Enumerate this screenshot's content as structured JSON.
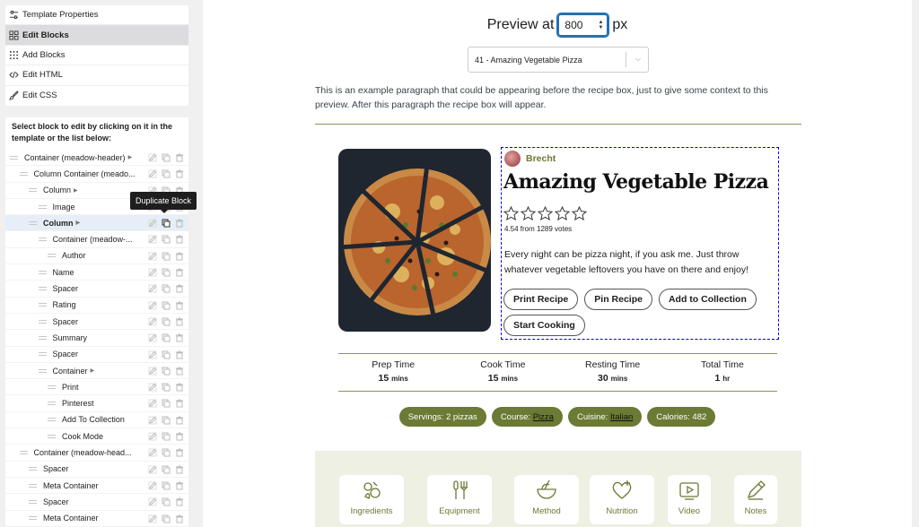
{
  "sidebar": {
    "menu": [
      {
        "label": "Template Properties",
        "icon": "sliders-icon"
      },
      {
        "label": "Edit Blocks",
        "icon": "grid-icon",
        "active": true
      },
      {
        "label": "Add Blocks",
        "icon": "dots-grid-icon"
      },
      {
        "label": "Edit HTML",
        "icon": "code-icon"
      },
      {
        "label": "Edit CSS",
        "icon": "brush-icon"
      }
    ],
    "instructions": "Select block to edit by clicking on it in the template or the list below:",
    "blocks": [
      {
        "label": "Container (meadow-header)",
        "indent": 0,
        "caret": true
      },
      {
        "label": "Column Container (meado...",
        "indent": 1,
        "caret": false
      },
      {
        "label": "Column",
        "indent": 2,
        "caret": true
      },
      {
        "label": "Image",
        "indent": 3,
        "caret": false
      },
      {
        "label": "Column",
        "indent": 2,
        "caret": true,
        "highlight": true
      },
      {
        "label": "Container (meadow-...",
        "indent": 3,
        "caret": false
      },
      {
        "label": "Author",
        "indent": 4,
        "caret": false
      },
      {
        "label": "Name",
        "indent": 3,
        "caret": false
      },
      {
        "label": "Spacer",
        "indent": 3,
        "caret": false
      },
      {
        "label": "Rating",
        "indent": 3,
        "caret": false
      },
      {
        "label": "Spacer",
        "indent": 3,
        "caret": false
      },
      {
        "label": "Summary",
        "indent": 3,
        "caret": false
      },
      {
        "label": "Spacer",
        "indent": 3,
        "caret": false
      },
      {
        "label": "Container",
        "indent": 3,
        "caret": true
      },
      {
        "label": "Print",
        "indent": 4,
        "caret": false
      },
      {
        "label": "Pinterest",
        "indent": 4,
        "caret": false
      },
      {
        "label": "Add To Collection",
        "indent": 4,
        "caret": false
      },
      {
        "label": "Cook Mode",
        "indent": 4,
        "caret": false
      },
      {
        "label": "Container (meadow-head...",
        "indent": 1,
        "caret": false
      },
      {
        "label": "Spacer",
        "indent": 2,
        "caret": false
      },
      {
        "label": "Meta Container",
        "indent": 2,
        "caret": false
      },
      {
        "label": "Spacer",
        "indent": 2,
        "caret": false
      },
      {
        "label": "Meta Container",
        "indent": 2,
        "caret": false
      }
    ],
    "tooltip": "Duplicate Block"
  },
  "preview": {
    "label": "Preview at",
    "width_value": "800",
    "unit": "px",
    "recipe_select": "41 - Amazing Vegetable Pizza",
    "intro": "This is an example paragraph that could be appearing before the recipe box, just to give some context to this preview. After this paragraph the recipe box will appear."
  },
  "recipe": {
    "author": "Brecht",
    "name": "Amazing Vegetable Pizza",
    "rating": 4.54,
    "votes_text": "4.54 from 1289 votes",
    "summary": "Every night can be pizza night, if you ask me. Just throw whatever vegetable leftovers you have on there and enjoy!",
    "buttons": [
      "Print Recipe",
      "Pin Recipe",
      "Add to Collection",
      "Start Cooking"
    ],
    "times": [
      {
        "label": "Prep Time",
        "value": "15",
        "unit": "mins"
      },
      {
        "label": "Cook Time",
        "value": "15",
        "unit": "mins"
      },
      {
        "label": "Resting Time",
        "value": "30",
        "unit": "mins"
      },
      {
        "label": "Total Time",
        "value": "1",
        "unit": "hr"
      }
    ],
    "tags": [
      {
        "prefix": "Servings: ",
        "value": "2 pizzas",
        "link": false
      },
      {
        "prefix": "Course: ",
        "value": "Pizza",
        "link": true
      },
      {
        "prefix": "Cuisine: ",
        "value": "Italian",
        "link": true
      },
      {
        "prefix": "Calories: ",
        "value": "482",
        "link": false
      }
    ],
    "nav": [
      {
        "label": "Ingredients",
        "icon": "ingredients-icon"
      },
      {
        "label": "Equipment",
        "icon": "utensils-icon"
      },
      {
        "label": "Method",
        "icon": "bowl-icon"
      },
      {
        "label": "Nutrition",
        "icon": "heart-plus-icon"
      },
      {
        "label": "Video",
        "icon": "video-icon"
      },
      {
        "label": "Notes",
        "icon": "pencil-icon"
      }
    ]
  },
  "colors": {
    "accent": "#6b7a34",
    "selection": "#0000e6",
    "focus": "#2271b1"
  }
}
